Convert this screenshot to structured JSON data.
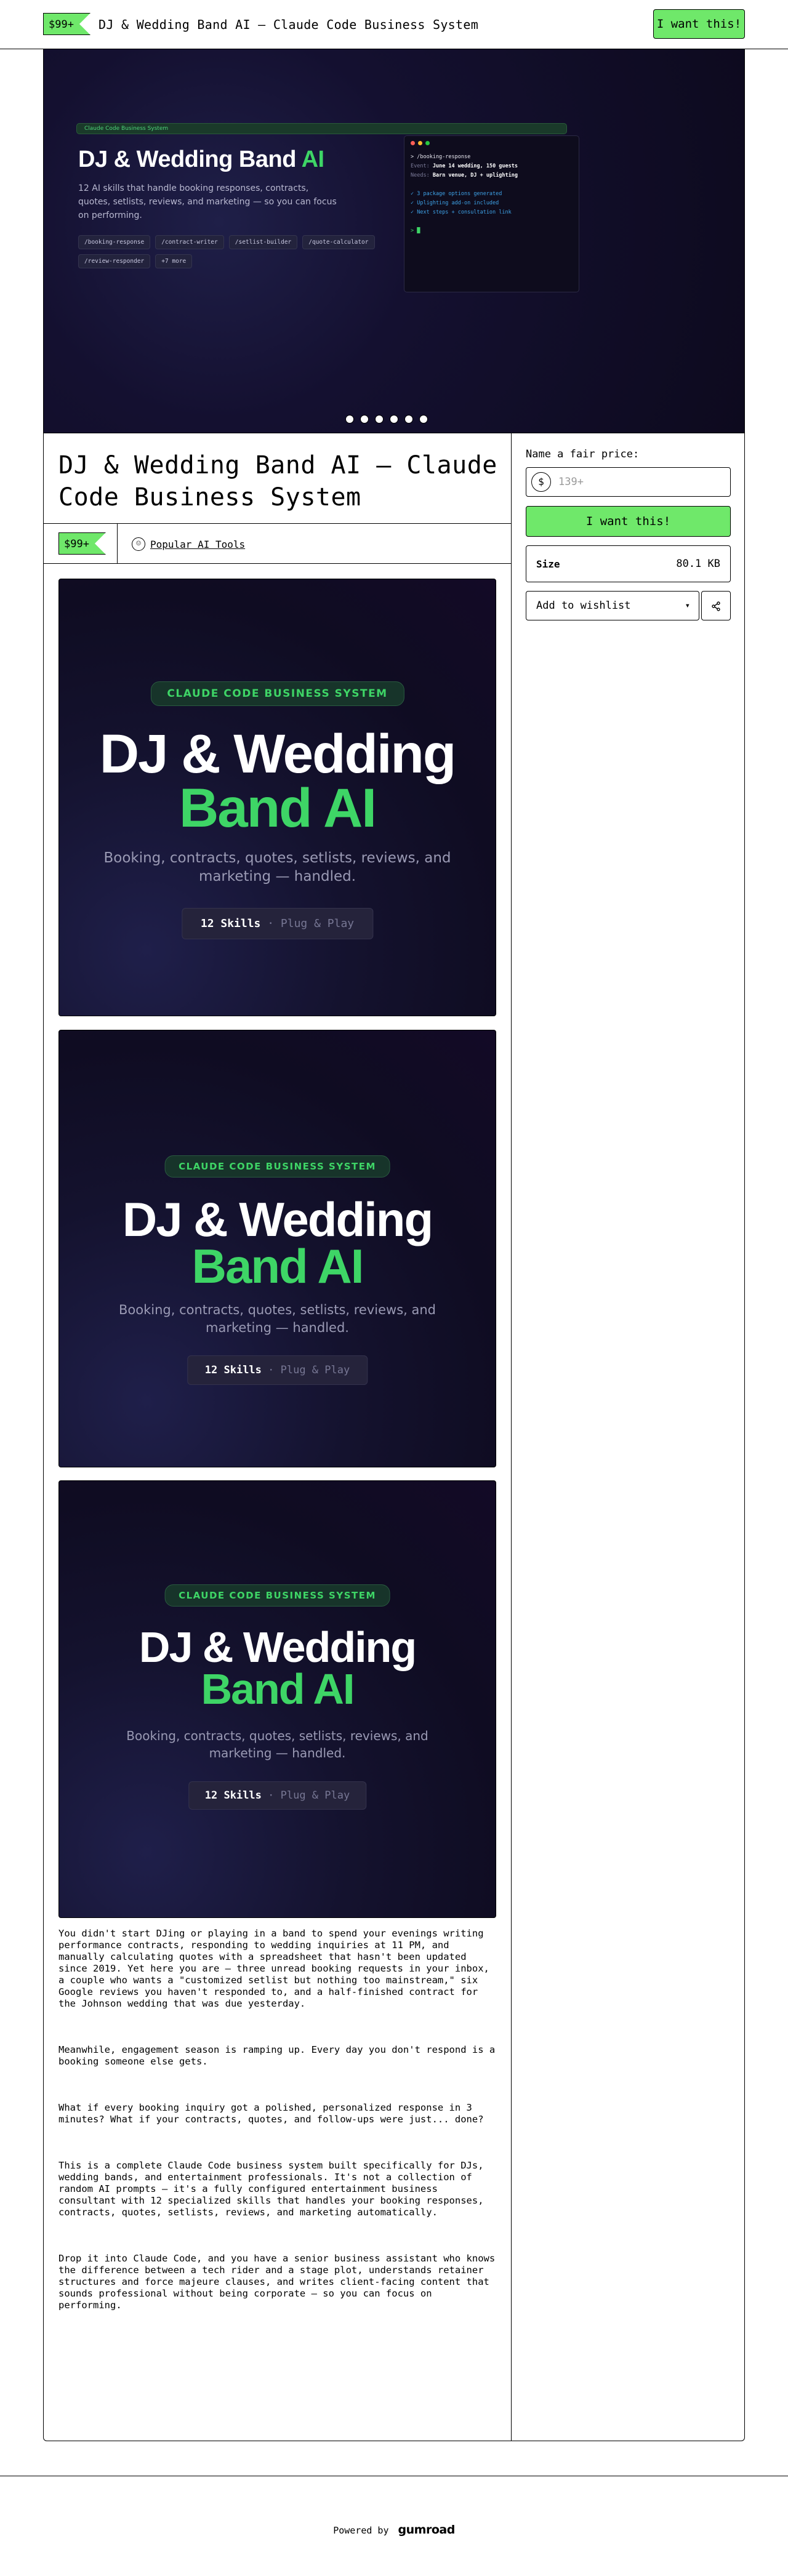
{
  "header": {
    "price": "$99+",
    "title": "DJ & Wedding Band AI — Claude Code Business System",
    "cta": "I want this!"
  },
  "hero": {
    "pill": "Claude Code Business System",
    "title_main": "DJ & Wedding Band",
    "title_accent": "AI",
    "description": "12 AI skills that handle booking responses, contracts, quotes, setlists, reviews, and marketing — so you can focus on performing.",
    "chips": [
      "/booking-response",
      "/contract-writer",
      "/setlist-builder",
      "/quote-calculator",
      "/review-responder",
      "+7 more"
    ],
    "terminal": {
      "command": "> /booking-response",
      "event_key": "Event:",
      "event_val": "June 14 wedding, 150 guests",
      "needs_key": "Needs:",
      "needs_val": "Barn venue, DJ + uplighting",
      "ok1": "✓ 3 package options generated",
      "ok2": "✓ Uplighting add-on included",
      "ok3": "✓ Next steps + consultation link",
      "prompt": "> █"
    },
    "carousel_count": 6
  },
  "product": {
    "title": "DJ & Wedding Band AI — Claude Code Business System",
    "price": "$99+",
    "creator": "Popular AI Tools"
  },
  "purchase": {
    "fair_price_label": "Name a fair price:",
    "currency_symbol": "$",
    "price_placeholder": "139+",
    "cta": "I want this!",
    "size_label": "Size",
    "size_value": "80.1 KB",
    "wishlist": "Add to wishlist"
  },
  "cover": {
    "badge": "CLAUDE CODE BUSINESS SYSTEM",
    "title_line1": "DJ & Wedding",
    "title_line2": "Band AI",
    "subtitle_line1": "Booking, contracts, quotes, setlists, reviews, and",
    "subtitle_line2": "marketing — handled.",
    "skills": "12 Skills",
    "sep": " · ",
    "plug": "Plug & Play"
  },
  "description": [
    "You didn't start DJing or playing in a band to spend your evenings writing performance contracts, responding to wedding inquiries at 11 PM, and manually calculating quotes with a spreadsheet that hasn't been updated since 2019. Yet here you are — three unread booking requests in your inbox, a couple who wants a \"customized setlist but nothing too mainstream,\" six Google reviews you haven't responded to, and a half-finished contract for the Johnson wedding that was due yesterday.",
    "Meanwhile, engagement season is ramping up. Every day you don't respond is a booking someone else gets.",
    "What if every booking inquiry got a polished, personalized response in 3 minutes? What if your contracts, quotes, and follow-ups were just... done?",
    "This is a complete Claude Code business system built specifically for DJs, wedding bands, and entertainment professionals. It's not a collection of random AI prompts — it's a fully configured entertainment business consultant with 12 specialized skills that handles your booking responses, contracts, quotes, setlists, reviews, and marketing automatically.",
    "Drop it into Claude Code, and you have a senior business assistant who knows the difference between a tech rider and a stage plot, understands retainer structures and force majeure clauses, and writes client-facing content that sounds professional without being corporate — so you can focus on performing."
  ],
  "footer": {
    "powered_by": "Powered by",
    "brand": "gumroad"
  }
}
